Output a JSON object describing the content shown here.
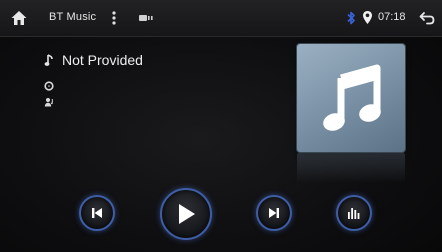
{
  "status_bar": {
    "app_title": "BT Music",
    "time": "07:18",
    "icons": {
      "home": "home-icon",
      "menu": "kebab-menu-icon",
      "bt_status": "bt-device-status-icon",
      "bluetooth": "bluetooth-icon",
      "location": "location-pin-icon",
      "back": "back-arrow-icon"
    },
    "accent_color": "#3a63d6"
  },
  "track": {
    "title": "Not Provided",
    "icons": {
      "title": "music-note-icon",
      "artist": "disc-icon",
      "album": "artist-icon"
    }
  },
  "album_art": {
    "icon": "music-note-icon"
  },
  "controls": {
    "buttons": [
      "previous-track",
      "play",
      "next-track",
      "equalizer"
    ],
    "ring_color": "#3f5ea8"
  }
}
